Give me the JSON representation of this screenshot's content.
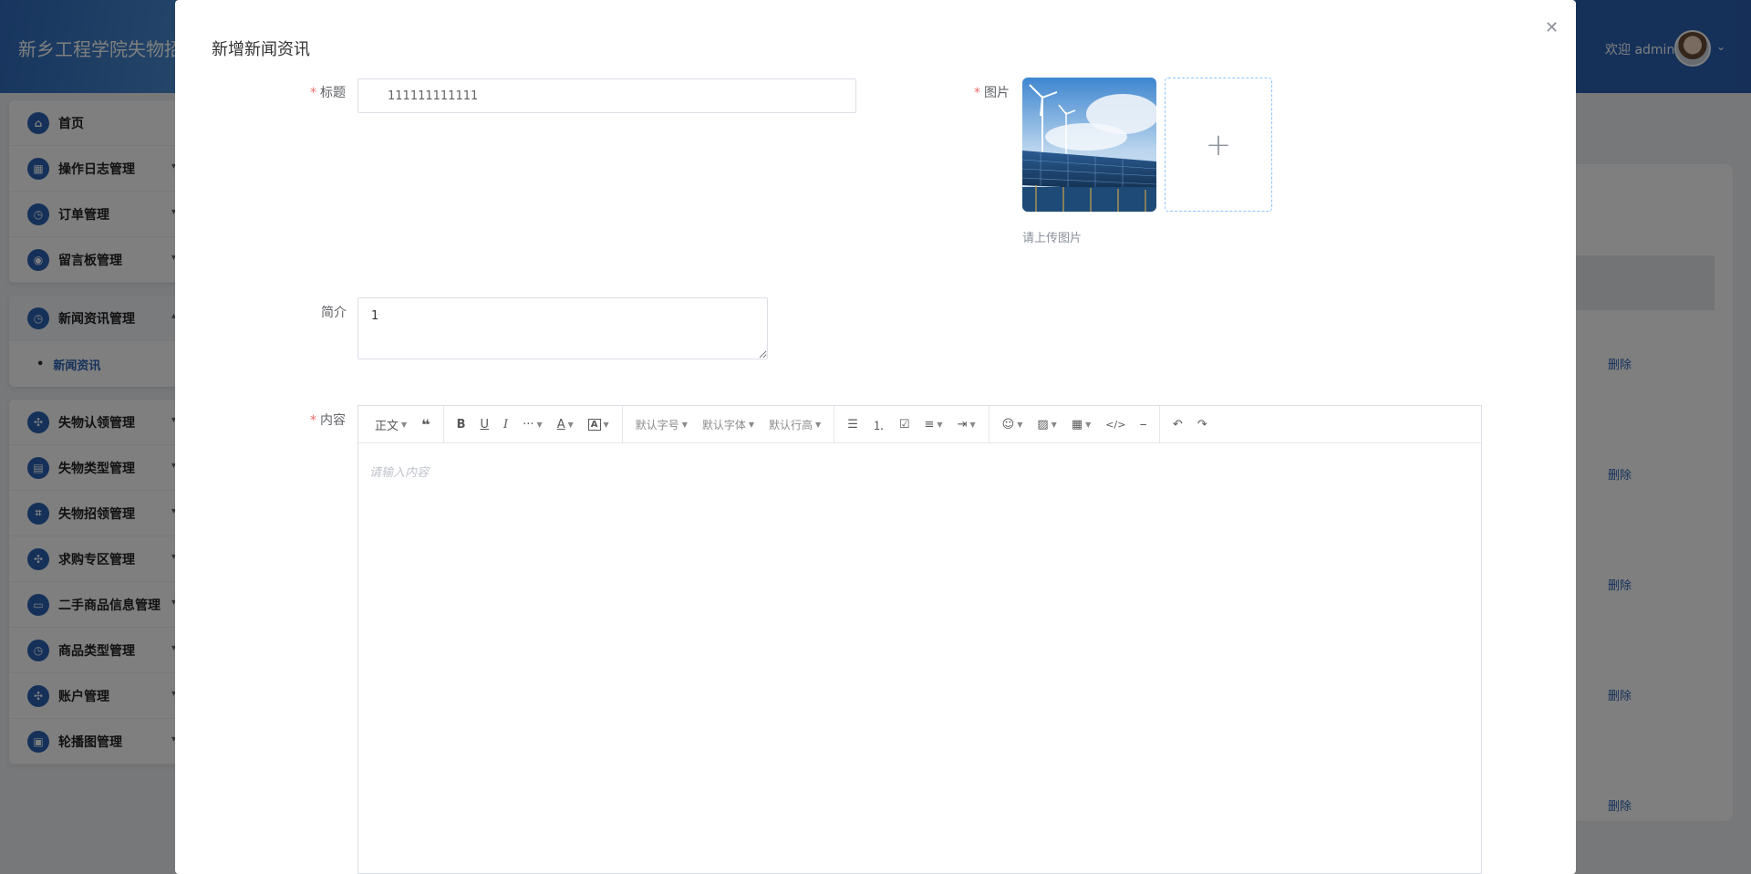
{
  "app": {
    "site_title": "新乡工程学院失物招领",
    "welcome": "欢迎 admin"
  },
  "sidebar": {
    "groups": [
      {
        "items": [
          {
            "label": "首页"
          },
          {
            "label": "操作日志管理"
          },
          {
            "label": "订单管理"
          },
          {
            "label": "留言板管理"
          }
        ]
      },
      {
        "items": [
          {
            "label": "新闻资讯管理"
          }
        ],
        "sub": [
          {
            "label": "新闻资讯"
          }
        ]
      },
      {
        "items": [
          {
            "label": "失物认领管理"
          },
          {
            "label": "失物类型管理"
          },
          {
            "label": "失物招领管理"
          },
          {
            "label": "求购专区管理"
          },
          {
            "label": "二手商品信息管理"
          },
          {
            "label": "商品类型管理"
          },
          {
            "label": "账户管理"
          },
          {
            "label": "轮播图管理"
          }
        ]
      }
    ]
  },
  "table": {
    "delete_label": "删除"
  },
  "dialog": {
    "title": "新增新闻资讯",
    "close_icon": "close-icon",
    "form": {
      "title_label": "标题",
      "title_value": "111111111111",
      "image_label": "图片",
      "image_hint": "请上传图片",
      "intro_label": "简介",
      "intro_value": "1",
      "content_label": "内容",
      "content_placeholder": "请输入内容"
    },
    "toolbar": {
      "paragraph": "正文",
      "font_size": "默认字号",
      "font_family": "默认字体",
      "line_height": "默认行高",
      "more": "···"
    }
  },
  "colors": {
    "brand": "#2a63b4",
    "required": "#f56c6c"
  }
}
